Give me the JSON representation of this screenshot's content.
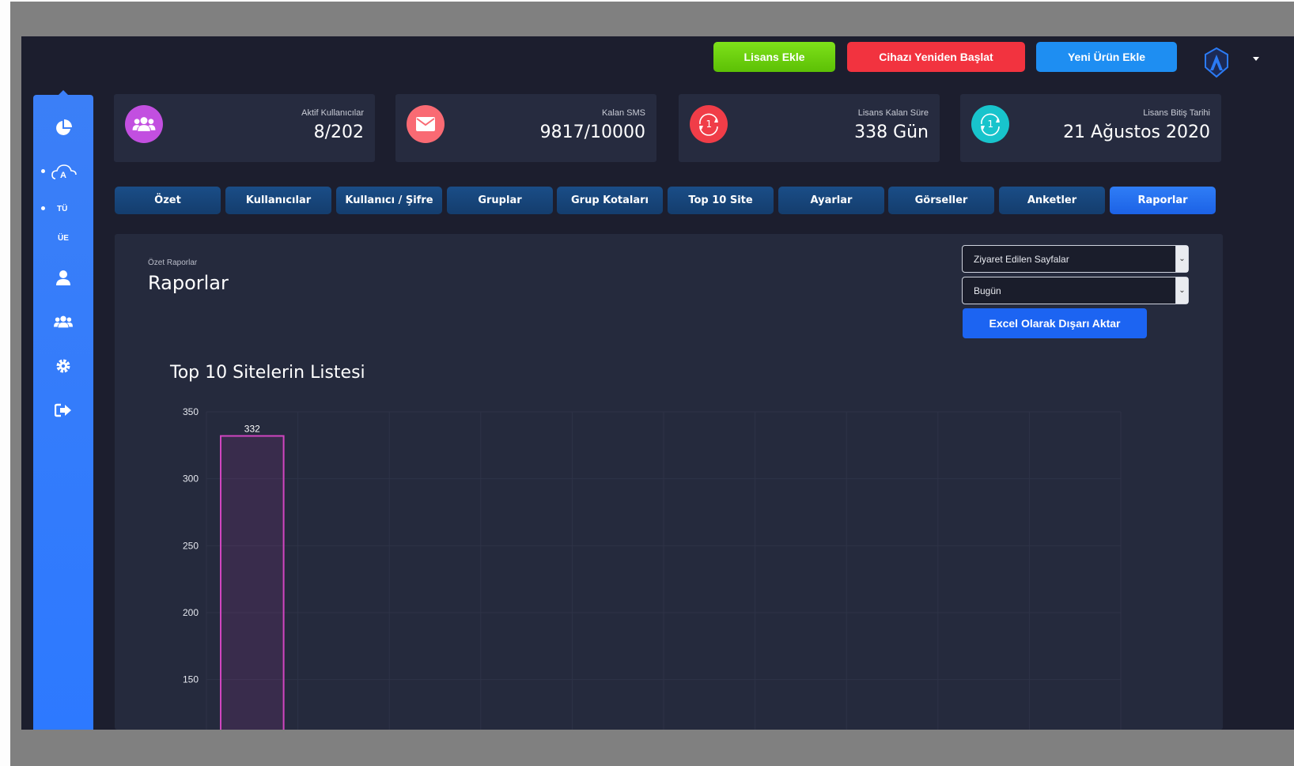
{
  "topbar": {
    "license_button": "Lisans Ekle",
    "restart_button": "Cihazı Yeniden Başlat",
    "new_product_button": "Yeni Ürün Ekle"
  },
  "sidebar": {
    "lang_tr": "TÜ",
    "lang_other": "ÜE"
  },
  "stats": [
    {
      "label": "Aktif Kullanıcılar",
      "value": "8/202",
      "icon": "users-icon",
      "color": "#c24fe0"
    },
    {
      "label": "Kalan SMS",
      "value": "9817/10000",
      "icon": "envelope-icon",
      "color": "#f96a73"
    },
    {
      "label": "Lisans Kalan Süre",
      "value": "338 Gün",
      "icon": "clock-icon",
      "color": "#f03d48"
    },
    {
      "label": "Lisans Bitiş Tarihi",
      "value": "21 Ağustos 2020",
      "icon": "clock-icon",
      "color": "#18c4cc"
    }
  ],
  "tabs": [
    "Özet",
    "Kullanıcılar",
    "Kullanıcı / Şifre",
    "Gruplar",
    "Grup Kotaları",
    "Top 10 Site",
    "Ayarlar",
    "Görseller",
    "Anketler",
    "Raporlar"
  ],
  "active_tab": "Raporlar",
  "panel": {
    "subtitle": "Özet Raporlar",
    "title": "Raporlar",
    "report_select": "Ziyaret Edilen Sayfalar",
    "period_select": "Bugün",
    "export_button": "Excel Olarak Dışarı Aktar",
    "chart_title": "Top 10 Sitelerin Listesi"
  },
  "chart_data": {
    "type": "bar",
    "title": "Top 10 Sitelerin Listesi",
    "categories": [
      "",
      "",
      "",
      "",
      "",
      "",
      "",
      "",
      "",
      ""
    ],
    "values": [
      332
    ],
    "data_labels": [
      "332"
    ],
    "yticks": [
      "350",
      "300",
      "250",
      "200",
      "150"
    ],
    "ylim": [
      0,
      350
    ],
    "grid": true,
    "bar_color": "#d045c0"
  }
}
